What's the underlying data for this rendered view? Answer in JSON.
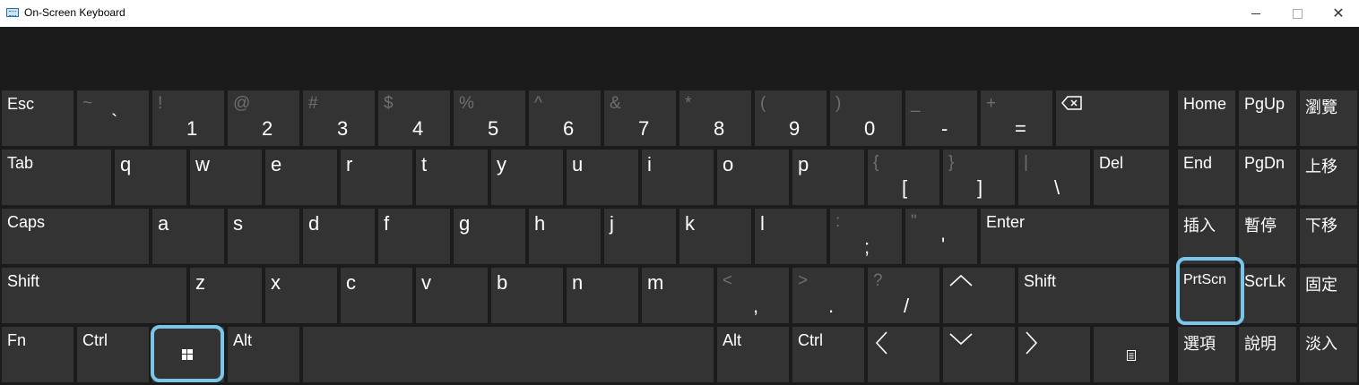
{
  "window": {
    "title": "On-Screen Keyboard"
  },
  "keys": {
    "esc": "Esc",
    "tilde_shift": "~",
    "tilde": "`",
    "k1_shift": "!",
    "k1": "1",
    "k2_shift": "@",
    "k2": "2",
    "k3_shift": "#",
    "k3": "3",
    "k4_shift": "$",
    "k4": "4",
    "k5_shift": "%",
    "k5": "5",
    "k6_shift": "^",
    "k6": "6",
    "k7_shift": "&",
    "k7": "7",
    "k8_shift": "*",
    "k8": "8",
    "k9_shift": "(",
    "k9": "9",
    "k0_shift": ")",
    "k0": "0",
    "minus_shift": "_",
    "minus": "-",
    "equal_shift": "+",
    "equal": "=",
    "tab": "Tab",
    "q": "q",
    "w": "w",
    "e": "e",
    "r": "r",
    "t": "t",
    "y": "y",
    "u": "u",
    "i": "i",
    "o": "o",
    "p": "p",
    "lbracket_shift": "{",
    "lbracket": "[",
    "rbracket_shift": "}",
    "rbracket": "]",
    "backslash_shift": "|",
    "backslash": "\\",
    "del": "Del",
    "caps": "Caps",
    "a": "a",
    "s": "s",
    "d": "d",
    "f": "f",
    "g": "g",
    "h": "h",
    "j": "j",
    "k": "k",
    "l": "l",
    "semicolon_shift": ":",
    "semicolon": ";",
    "quote_shift": "\"",
    "quote": "'",
    "enter": "Enter",
    "shift": "Shift",
    "z": "z",
    "x": "x",
    "c": "c",
    "v": "v",
    "b": "b",
    "n": "n",
    "m": "m",
    "comma_shift": "<",
    "comma": ",",
    "period_shift": ">",
    "period": ".",
    "slash_shift": "?",
    "slash": "/",
    "shift_right": "Shift",
    "fn": "Fn",
    "ctrl": "Ctrl",
    "alt": "Alt",
    "alt_right": "Alt",
    "ctrl_right": "Ctrl",
    "home": "Home",
    "pgup": "PgUp",
    "browse": "瀏覽",
    "end": "End",
    "pgdn": "PgDn",
    "move_up": "上移",
    "insert": "插入",
    "pause": "暫停",
    "move_down": "下移",
    "prtscn": "PrtScn",
    "scrlk": "ScrLk",
    "dock": "固定",
    "options": "選項",
    "help": "說明",
    "fade": "淡入"
  },
  "highlight_color": "#79c6ea",
  "key_color": "#333333",
  "background_color": "#1b1b1b"
}
